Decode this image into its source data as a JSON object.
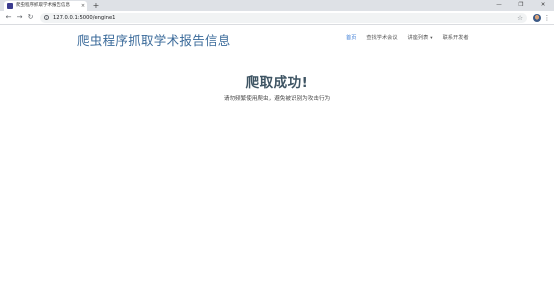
{
  "browser": {
    "tab_title": "爬虫程序抓取学术报告信息",
    "tab_close": "×",
    "new_tab": "+",
    "window_controls": [
      "—",
      "❐",
      "✕"
    ],
    "url": "127.0.0.1:5000/engine1",
    "nav": {
      "back": "←",
      "forward": "→",
      "reload": "↻"
    },
    "star": "☆",
    "menu": "⋮"
  },
  "site": {
    "title": "爬虫程序抓取学术报告信息",
    "nav": [
      {
        "label": "首页",
        "active": true
      },
      {
        "label": "查找学术会议",
        "active": false
      },
      {
        "label": "讲座列表",
        "active": false,
        "dropdown": true
      },
      {
        "label": "联系开发者",
        "active": false
      }
    ],
    "nav_caret": "▾"
  },
  "main": {
    "headline": "爬取成功!",
    "subtext": "请勿频繁使用爬虫，避免被识别为攻击行为"
  },
  "colors": {
    "title": "#3a6a9a",
    "nav_active": "#3a7bd5",
    "headline": "#3e5463"
  }
}
